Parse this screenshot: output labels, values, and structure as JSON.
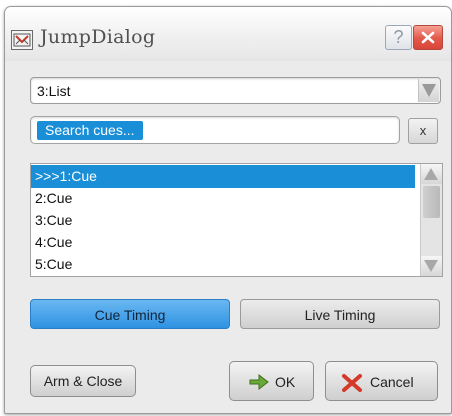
{
  "window": {
    "title": "JumpDialog"
  },
  "titlebar": {
    "help_glyph": "?",
    "close_icon": "close-icon"
  },
  "list_combo": {
    "selected": "3:List"
  },
  "search": {
    "value": "Search cues...",
    "clear_label": "x"
  },
  "cue_list": {
    "items": [
      ">>>1:Cue",
      "2:Cue",
      "3:Cue",
      "4:Cue",
      "5:Cue"
    ],
    "selected_index": 0
  },
  "timing": {
    "cue_timing_label": "Cue Timing",
    "live_timing_label": "Live Timing",
    "active": "Cue Timing"
  },
  "buttons": {
    "arm_close_label": "Arm & Close",
    "ok_label": "OK",
    "cancel_label": "Cancel"
  },
  "colors": {
    "selection": "#1a8fd8",
    "close_red": "#e2574a",
    "ok_green": "#5a9a2e",
    "cancel_red": "#d43a2a"
  }
}
